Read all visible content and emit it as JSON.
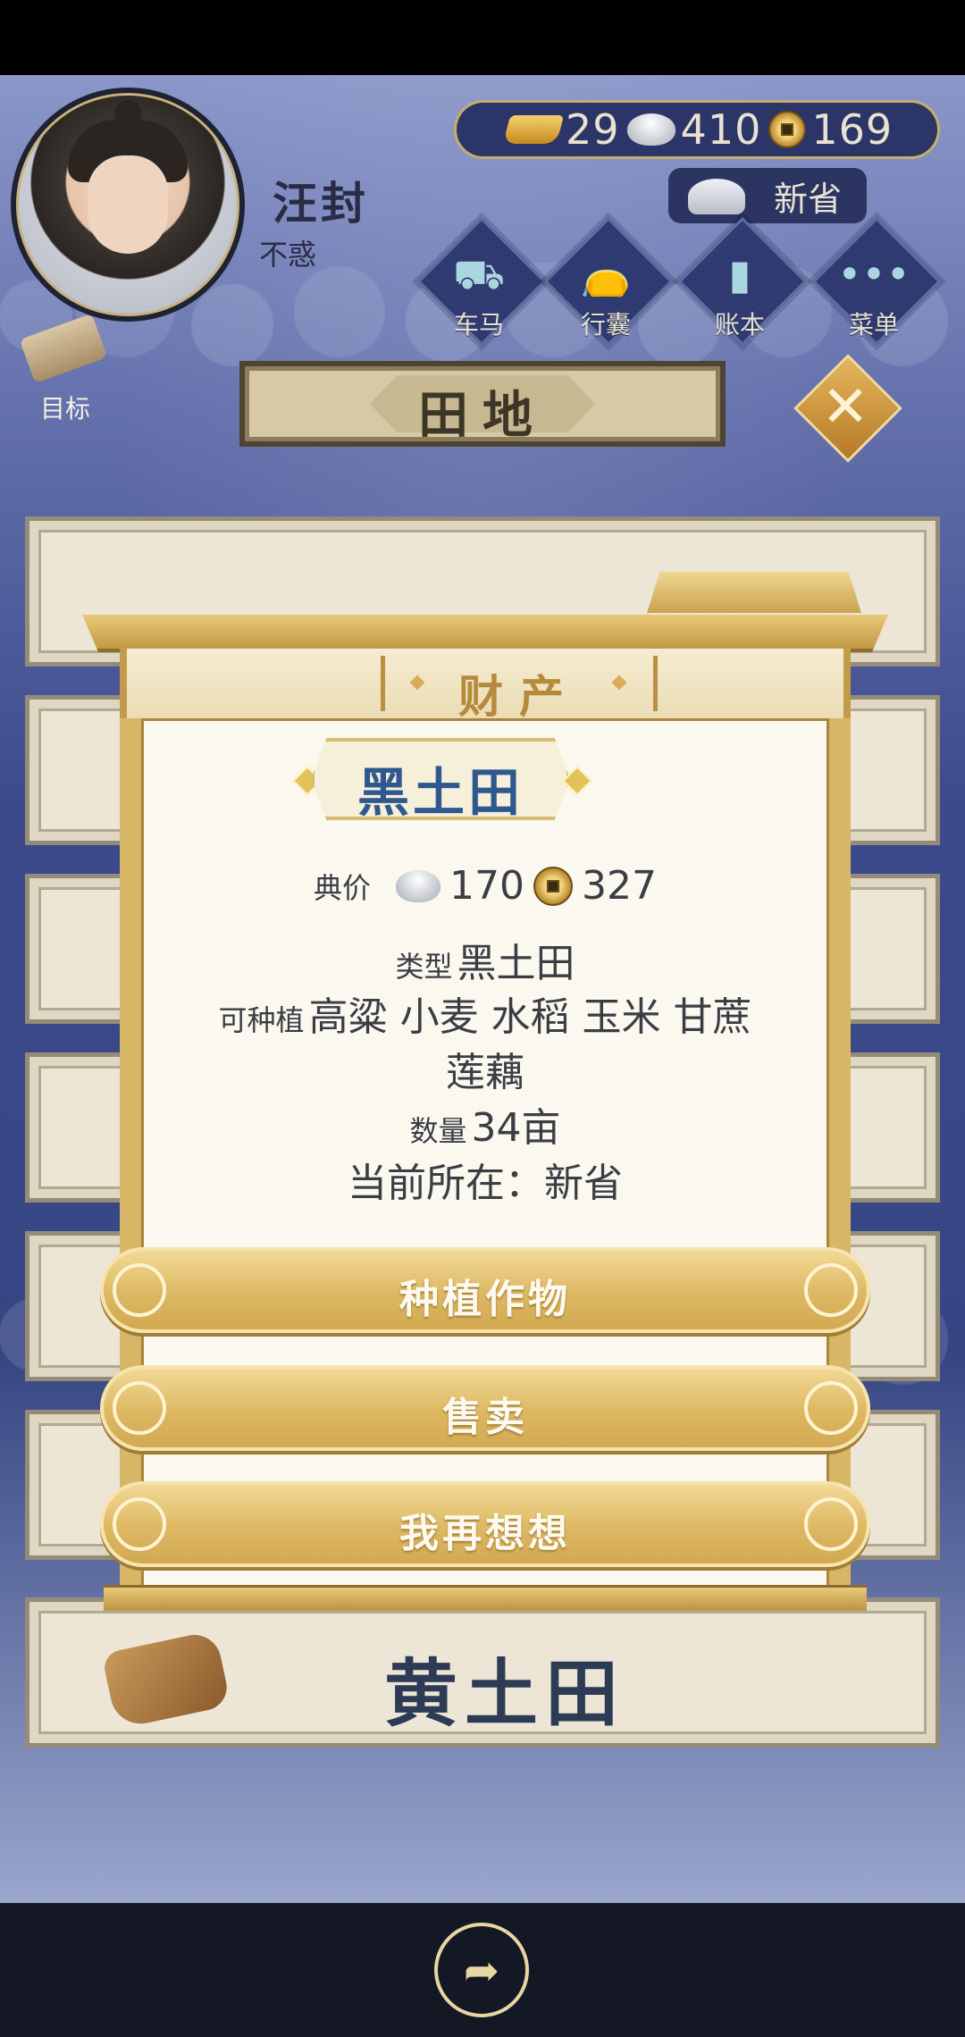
{
  "player": {
    "name": "汪封",
    "age_title": "不惑"
  },
  "currency": {
    "gold": "29",
    "silver": "410",
    "copper": "169"
  },
  "location": {
    "label": "新省"
  },
  "top_menu": [
    {
      "label": "车马",
      "icon": "carriage-icon"
    },
    {
      "label": "行囊",
      "icon": "bag-icon"
    },
    {
      "label": "账本",
      "icon": "ledger-icon"
    },
    {
      "label": "菜单",
      "icon": "more-icon"
    }
  ],
  "goal": {
    "label": "目标"
  },
  "page": {
    "title": "田地"
  },
  "list": {
    "visible_row_label": "黄土田"
  },
  "dialog": {
    "section": "财产",
    "item_name": "黑土田",
    "price_label": "典价",
    "price_silver": "170",
    "price_copper": "327",
    "type_label": "类型",
    "type_value": "黑土田",
    "plantable_label": "可种植",
    "plantable_value": "高粱 小麦 水稻 玉米 甘蔗",
    "plantable_value_2": "莲藕",
    "quantity_label": "数量",
    "quantity_value": "34亩",
    "location_text": "当前所在：新省",
    "buttons": {
      "plant": "种植作物",
      "sell": "售卖",
      "cancel": "我再想想"
    }
  },
  "colors": {
    "accent": "#d7b667",
    "title_blue": "#2f588f",
    "background": "#3c4a8c"
  }
}
